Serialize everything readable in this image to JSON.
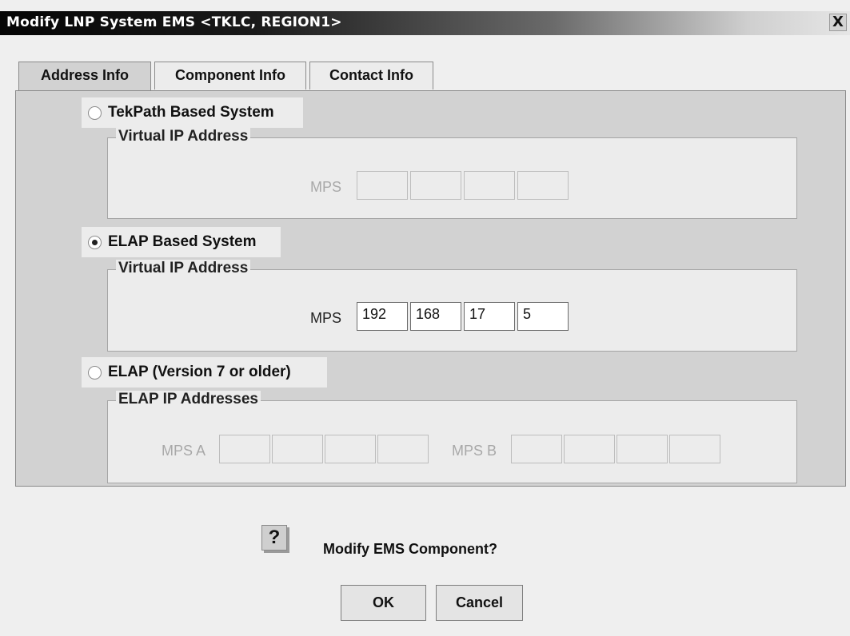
{
  "window": {
    "title": "Modify LNP System EMS <TKLC, REGION1>",
    "close_label": "X"
  },
  "tabs": [
    {
      "label": "Address Info",
      "selected": true
    },
    {
      "label": "Component Info",
      "selected": false
    },
    {
      "label": "Contact Info",
      "selected": false
    }
  ],
  "options": {
    "tekpath": {
      "label": "TekPath Based System",
      "selected": false,
      "group_title": "Virtual IP Address",
      "mps_label": "MPS",
      "octets": [
        "",
        "",
        "",
        ""
      ]
    },
    "elap": {
      "label": "ELAP Based System",
      "selected": true,
      "group_title": "Virtual IP Address",
      "mps_label": "MPS",
      "octets": [
        "192",
        "168",
        "17",
        "5"
      ]
    },
    "elap_old": {
      "label": "ELAP (Version 7 or older)",
      "selected": false,
      "group_title": "ELAP IP Addresses",
      "mps_a_label": "MPS A",
      "mps_b_label": "MPS B",
      "mps_a_octets": [
        "",
        "",
        "",
        ""
      ],
      "mps_b_octets": [
        "",
        "",
        "",
        ""
      ]
    }
  },
  "confirm": {
    "icon": "question-icon",
    "icon_glyph": "?",
    "message": "Modify EMS Component?",
    "ok_label": "OK",
    "cancel_label": "Cancel"
  }
}
